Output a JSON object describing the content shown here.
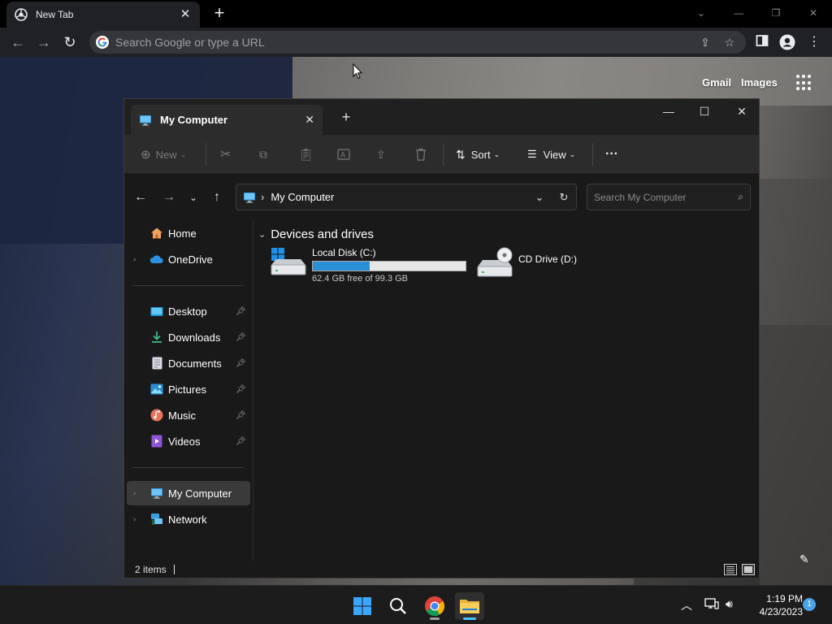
{
  "browser": {
    "tab_title": "New Tab",
    "omnibox_placeholder": "Search Google or type a URL",
    "links": {
      "gmail": "Gmail",
      "images": "Images"
    }
  },
  "explorer": {
    "tab_title": "My Computer",
    "command_bar": {
      "new_label": "New",
      "sort_label": "Sort",
      "view_label": "View",
      "more_label": "···"
    },
    "address": {
      "breadcrumb": "My Computer",
      "search_placeholder": "Search My Computer"
    },
    "nav_pane": {
      "top": [
        {
          "label": "Home",
          "icon": "home-icon"
        },
        {
          "label": "OneDrive",
          "icon": "onedrive-icon"
        }
      ],
      "pinned": [
        {
          "label": "Desktop",
          "icon": "desktop-folder-icon"
        },
        {
          "label": "Downloads",
          "icon": "downloads-folder-icon"
        },
        {
          "label": "Documents",
          "icon": "documents-folder-icon"
        },
        {
          "label": "Pictures",
          "icon": "pictures-folder-icon"
        },
        {
          "label": "Music",
          "icon": "music-folder-icon"
        },
        {
          "label": "Videos",
          "icon": "videos-folder-icon"
        }
      ],
      "bottom": [
        {
          "label": "My Computer",
          "icon": "computer-icon",
          "selected": true
        },
        {
          "label": "Network",
          "icon": "network-icon"
        }
      ]
    },
    "content": {
      "group_title": "Devices and drives",
      "drives": [
        {
          "name": "Local Disk (C:)",
          "free_text": "62.4 GB free of 99.3 GB",
          "used_fraction": 0.372,
          "icon": "hard-drive-windows-icon"
        },
        {
          "name": "CD Drive (D:)",
          "icon": "cd-drive-icon"
        }
      ]
    },
    "status": {
      "item_count": "2 items"
    }
  },
  "taskbar": {
    "apps": [
      "start-icon",
      "search-icon",
      "chrome-icon",
      "file-explorer-icon"
    ],
    "clock_time": "1:19 PM",
    "clock_date": "4/23/2023",
    "notification_count": "1"
  },
  "colors": {
    "accent": "#4cc2ff",
    "drive_fill": "#2b8fd6",
    "explorer_bg": "#191919",
    "command_bar_bg": "#2c2c2c"
  }
}
